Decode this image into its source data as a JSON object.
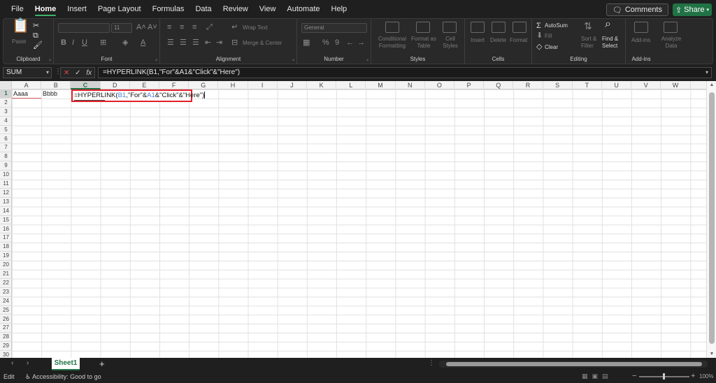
{
  "menu": {
    "tabs": [
      "File",
      "Home",
      "Insert",
      "Page Layout",
      "Formulas",
      "Data",
      "Review",
      "View",
      "Automate",
      "Help"
    ],
    "active_tab": "Home",
    "comments_label": "Comments",
    "share_label": "Share"
  },
  "ribbon": {
    "clipboard": {
      "label": "Clipboard",
      "paste_label": "Paste"
    },
    "font": {
      "label": "Font",
      "font_size": "11"
    },
    "alignment": {
      "label": "Alignment",
      "wrap_text": "Wrap Text",
      "merge_center": "Merge & Center"
    },
    "number": {
      "label": "Number",
      "format": "General"
    },
    "styles": {
      "label": "Styles",
      "conditional_formatting": "Conditional Formatting",
      "format_as_table": "Format as Table",
      "cell_styles": "Cell Styles"
    },
    "cells": {
      "label": "Cells",
      "insert": "Insert",
      "delete": "Delete",
      "format": "Format"
    },
    "editing": {
      "label": "Editing",
      "autosum": "AutoSum",
      "fill": "Fill",
      "clear": "Clear",
      "sort_filter": "Sort & Filter",
      "find_select": "Find & Select"
    },
    "addins": {
      "label": "Add-ins",
      "addins": "Add-ins",
      "analyze_data": "Analyze Data"
    }
  },
  "formula_bar": {
    "name_box": "SUM",
    "formula": "=HYPERLINK(B1,\"For\"&A1&\"Click\"&\"Here\")"
  },
  "grid": {
    "columns": [
      "A",
      "B",
      "C",
      "D",
      "E",
      "F",
      "G",
      "H",
      "I",
      "J",
      "K",
      "L",
      "M",
      "N",
      "O",
      "P",
      "Q",
      "R",
      "S",
      "T",
      "U",
      "V",
      "W"
    ],
    "selected_column": "C",
    "rows": [
      "1",
      "2",
      "3",
      "4",
      "5",
      "6",
      "7",
      "8",
      "9",
      "10",
      "11",
      "12",
      "13",
      "14",
      "15",
      "16",
      "17",
      "18",
      "19",
      "20",
      "21",
      "22",
      "23",
      "24",
      "25",
      "26",
      "27",
      "28",
      "29",
      "30"
    ],
    "selected_row": "1",
    "cells": {
      "A1": "Aaaa",
      "B1": "Bbbb"
    },
    "editing_cell": {
      "prefix": "=HYPERLINK(",
      "ref1": "B1",
      "mid": ",\"For\"&",
      "ref2": "A1",
      "suffix": "&\"Click\"&\"Here\")"
    }
  },
  "sheets": {
    "tabs": [
      "Sheet1"
    ],
    "active": "Sheet1"
  },
  "status": {
    "mode": "Edit",
    "accessibility": "Accessibility: Good to go",
    "zoom": "100%"
  },
  "colors": {
    "accent": "#217346",
    "highlight": "#e0202a",
    "ref_blue": "#4a7fd0"
  }
}
